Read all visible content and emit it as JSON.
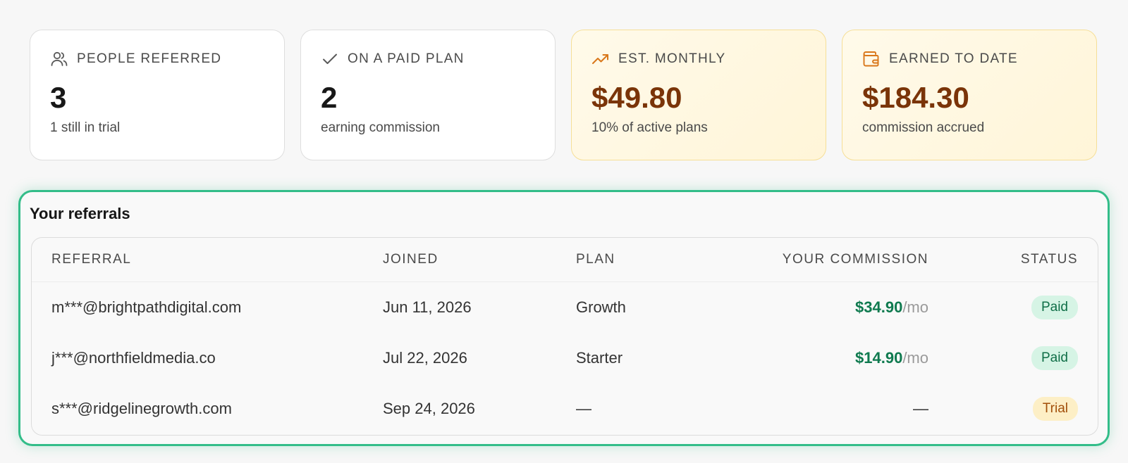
{
  "stats": [
    {
      "icon": "people-icon",
      "label": "PEOPLE REFERRED",
      "value": "3",
      "sub": "1 still in trial",
      "accent": "#5a5a5a"
    },
    {
      "icon": "check-icon",
      "label": "ON A PAID PLAN",
      "value": "2",
      "sub": "earning commission",
      "accent": "#5a5a5a"
    },
    {
      "icon": "trending-up-icon",
      "label": "EST. MONTHLY",
      "value": "$49.80",
      "sub": "10% of active plans",
      "accent": "#d9771a"
    },
    {
      "icon": "wallet-icon",
      "label": "EARNED TO DATE",
      "value": "$184.30",
      "sub": "commission accrued",
      "accent": "#d9771a"
    }
  ],
  "referrals": {
    "title": "Your referrals",
    "columns": [
      "REFERRAL",
      "JOINED",
      "PLAN",
      "YOUR COMMISSION",
      "STATUS"
    ],
    "rows": [
      {
        "email": "m***@brightpathdigital.com",
        "joined": "Jun 11, 2026",
        "plan": "Growth",
        "commission": "$34.90",
        "per": "/mo",
        "status": "Paid"
      },
      {
        "email": "j***@northfieldmedia.co",
        "joined": "Jul 22, 2026",
        "plan": "Starter",
        "commission": "$14.90",
        "per": "/mo",
        "status": "Paid"
      },
      {
        "email": "s***@ridgelinegrowth.com",
        "joined": "Sep 24, 2026",
        "plan": "—",
        "commission": "—",
        "per": "",
        "status": "Trial"
      }
    ]
  },
  "colors": {
    "highlight": "#33bd89",
    "money": "#0f7a4f",
    "gold_value": "#7a3408"
  }
}
